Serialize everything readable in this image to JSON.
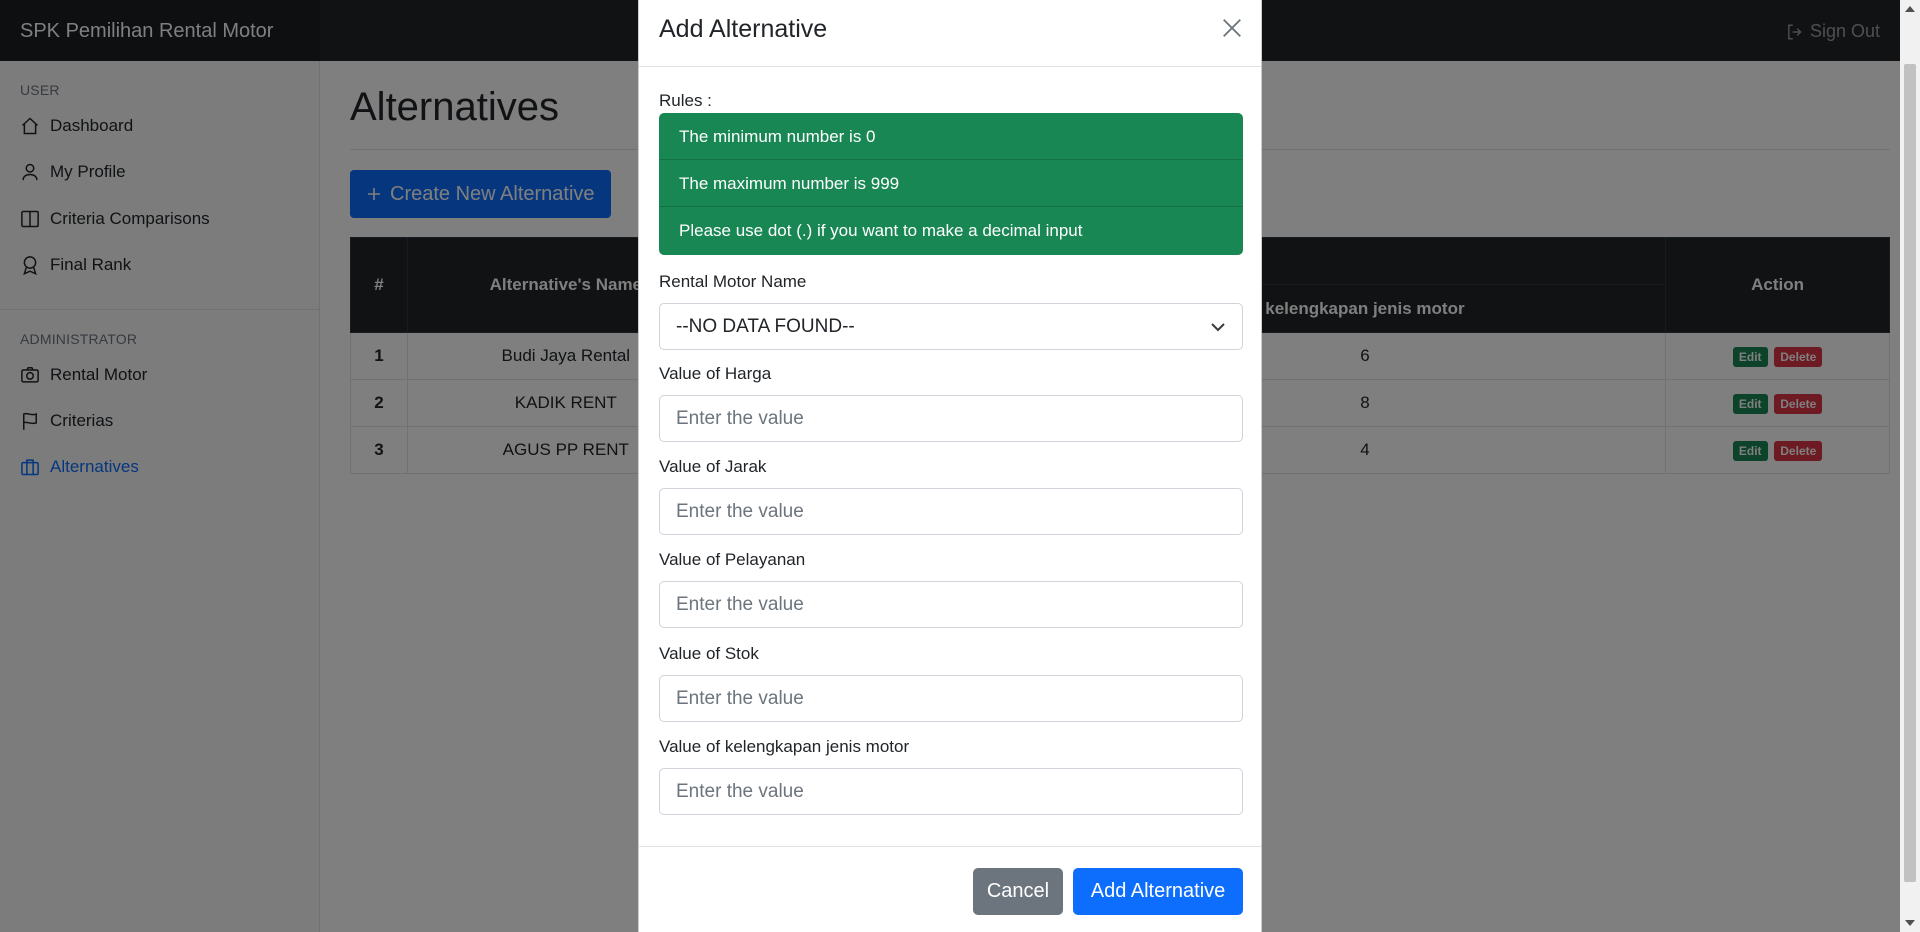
{
  "navbar": {
    "brand": "SPK Pemilihan Rental Motor",
    "signout_label": "Sign Out"
  },
  "sidebar": {
    "user_heading": "USER",
    "user_items": [
      {
        "label": "Dashboard",
        "icon": "house-icon"
      },
      {
        "label": "My Profile",
        "icon": "person-icon"
      },
      {
        "label": "Criteria Comparisons",
        "icon": "layout-split-icon"
      },
      {
        "label": "Final Rank",
        "icon": "award-icon"
      }
    ],
    "admin_heading": "ADMINISTRATOR",
    "admin_items": [
      {
        "label": "Rental Motor",
        "icon": "camera-icon"
      },
      {
        "label": "Criterias",
        "icon": "flag-icon"
      },
      {
        "label": "Alternatives",
        "icon": "briefcase-icon",
        "active": true
      }
    ]
  },
  "main": {
    "title": "Alternatives",
    "create_button": "Create New Alternative",
    "table": {
      "headers": [
        "#",
        "Alternative's Name",
        "kelengkapan jenis motor",
        "Action"
      ],
      "rows": [
        {
          "no": "1",
          "name": "Budi Jaya Rental",
          "kelengkapan": "6"
        },
        {
          "no": "2",
          "name": "KADIK RENT",
          "kelengkapan": "8"
        },
        {
          "no": "3",
          "name": "AGUS PP RENT",
          "kelengkapan": "4"
        }
      ],
      "edit_label": "Edit",
      "delete_label": "Delete"
    }
  },
  "modal": {
    "title": "Add Alternative",
    "rules_label": "Rules :",
    "rules": [
      "The minimum number is 0",
      "The maximum number is 999",
      "Please use dot (.) if you want to make a decimal input"
    ],
    "select_label": "Rental Motor Name",
    "select_value": "--NO DATA FOUND--",
    "fields": [
      {
        "label": "Value of Harga",
        "placeholder": "Enter the value"
      },
      {
        "label": "Value of Jarak",
        "placeholder": "Enter the value"
      },
      {
        "label": "Value of Pelayanan",
        "placeholder": "Enter the value"
      },
      {
        "label": "Value of Stok",
        "placeholder": "Enter the value"
      },
      {
        "label": "Value of kelengkapan jenis motor",
        "placeholder": "Enter the value"
      }
    ],
    "cancel_label": "Cancel",
    "submit_label": "Add Alternative"
  },
  "colors": {
    "primary": "#0d6efd",
    "success": "#198754",
    "danger": "#dc3545",
    "secondary": "#6c757d",
    "dark": "#212529"
  }
}
